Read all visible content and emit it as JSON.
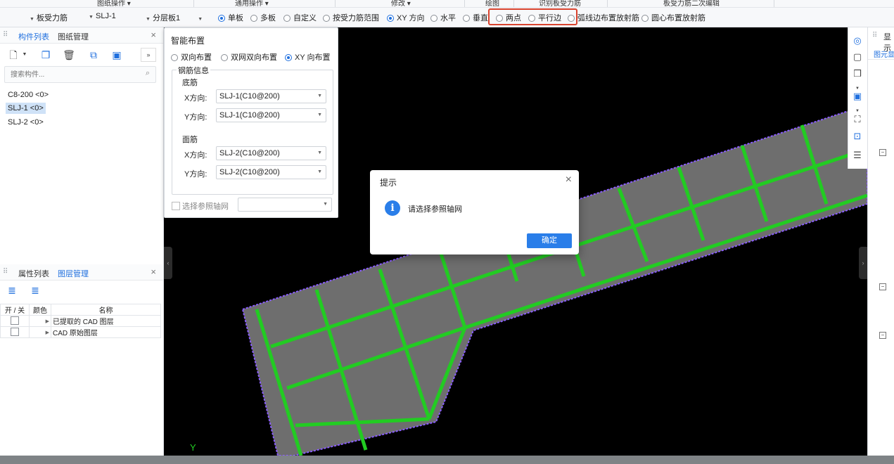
{
  "ribbon": {
    "groups": [
      "图纸操作 ▾",
      "通用操作 ▾",
      "修改 ▾",
      "绘图",
      "识别板受力筋",
      "板受力筋二次编辑"
    ]
  },
  "toolbar": {
    "type_select": "板受力筋",
    "name_select": "SLJ-1",
    "floor_select": "分层板1",
    "radios": [
      {
        "label": "单板",
        "checked": true
      },
      {
        "label": "多板",
        "checked": false
      },
      {
        "label": "自定义",
        "checked": false
      },
      {
        "label": "按受力筋范围",
        "checked": false
      },
      {
        "label": "XY 方向",
        "checked": true
      },
      {
        "label": "水平",
        "checked": false
      },
      {
        "label": "垂直",
        "checked": false
      },
      {
        "label": "两点",
        "checked": false
      },
      {
        "label": "平行边",
        "checked": false
      },
      {
        "label": "弧线边布置放射筋",
        "checked": false
      },
      {
        "label": "圆心布置放射筋",
        "checked": false
      }
    ]
  },
  "component_panel": {
    "tab_active": "构件列表",
    "tab_other": "图纸管理",
    "close": "×",
    "search_placeholder": "搜索构件...",
    "items": [
      {
        "label": "C8-200 <0>",
        "selected": false
      },
      {
        "label": "SLJ-1 <0>",
        "selected": true
      },
      {
        "label": "SLJ-2 <0>",
        "selected": false
      }
    ]
  },
  "layer_panel": {
    "tab_other": "属性列表",
    "tab_active": "图层管理",
    "close": "×",
    "columns": [
      "开 / 关",
      "颜色",
      "名称"
    ],
    "rows": [
      {
        "name": "已提取的 CAD 图层"
      },
      {
        "name": "CAD 原始图层"
      }
    ]
  },
  "smart_panel": {
    "title": "智能布置",
    "modes": [
      {
        "label": "双向布置",
        "checked": false
      },
      {
        "label": "双网双向布置",
        "checked": false
      },
      {
        "label": "XY 向布置",
        "checked": true
      }
    ],
    "group_label": "钢筋信息",
    "bottom_label": "底筋",
    "top_label": "面筋",
    "x_label": "X方向:",
    "y_label": "Y方向:",
    "bottom_x": "SLJ-1(C10@200)",
    "bottom_y": "SLJ-1(C10@200)",
    "top_x": "SLJ-2(C10@200)",
    "top_y": "SLJ-2(C10@200)",
    "ref_axis_label": "选择参照轴网",
    "ref_axis_value": ""
  },
  "dialog": {
    "title": "提示",
    "message": "请选择参照轴网",
    "ok": "确定",
    "close": "×"
  },
  "right_panel": {
    "tab": "显示",
    "sub_tab": "图元显"
  },
  "canvas": {
    "axis_label": "Y",
    "slab_color": "#6e6e6e",
    "rebar_color": "#22cc22",
    "boundary_color": "#8a5cff"
  }
}
